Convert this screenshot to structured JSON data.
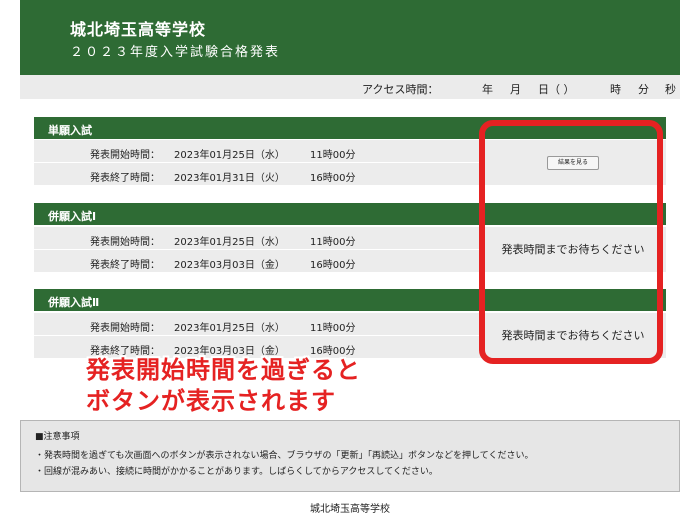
{
  "header": {
    "school": "城北埼玉高等学校",
    "subtitle": "２０２３年度入学試験合格発表"
  },
  "access": {
    "label": "アクセス時間：",
    "year": "年",
    "month": "月",
    "day": "日（ ）",
    "hour": "時",
    "minute": "分",
    "second": "秒"
  },
  "sections": [
    {
      "title": "単願入試",
      "start_label": "発表開始時間：",
      "start_date": "2023年01月25日（水）",
      "start_time": "11時00分",
      "end_label": "発表終了時間：",
      "end_date": "2023年01月31日（火）",
      "end_time": "16時00分",
      "button": "結果を見る"
    },
    {
      "title": "併願入試Ⅰ",
      "start_label": "発表開始時間：",
      "start_date": "2023年01月25日（水）",
      "start_time": "11時00分",
      "end_label": "発表終了時間：",
      "end_date": "2023年03月03日（金）",
      "end_time": "16時00分",
      "wait": "発表時間までお待ちください"
    },
    {
      "title": "併願入試Ⅱ",
      "start_label": "発表開始時間：",
      "start_date": "2023年01月25日（水）",
      "start_time": "11時00分",
      "end_label": "発表終了時間：",
      "end_date": "2023年03月03日（金）",
      "end_time": "16時00分",
      "wait": "発表時間までお待ちください"
    }
  ],
  "callout": {
    "line1": "発表開始時間を過ぎると",
    "line2": "ボタンが表示されます"
  },
  "notes": {
    "heading": "■注意事項",
    "items": [
      "・発表時間を過ぎても次画面へのボタンが表示されない場合、ブラウザの「更新」「再読込」ボタンなどを押してください。",
      "・回線が混みあい、接続に時間がかかることがあります。しばらくしてからアクセスしてください。"
    ]
  },
  "footer": "城北埼玉高等学校",
  "colors": {
    "header_green": "#2e6b34",
    "callout_red": "#e52222",
    "row_gray": "#ececec"
  }
}
